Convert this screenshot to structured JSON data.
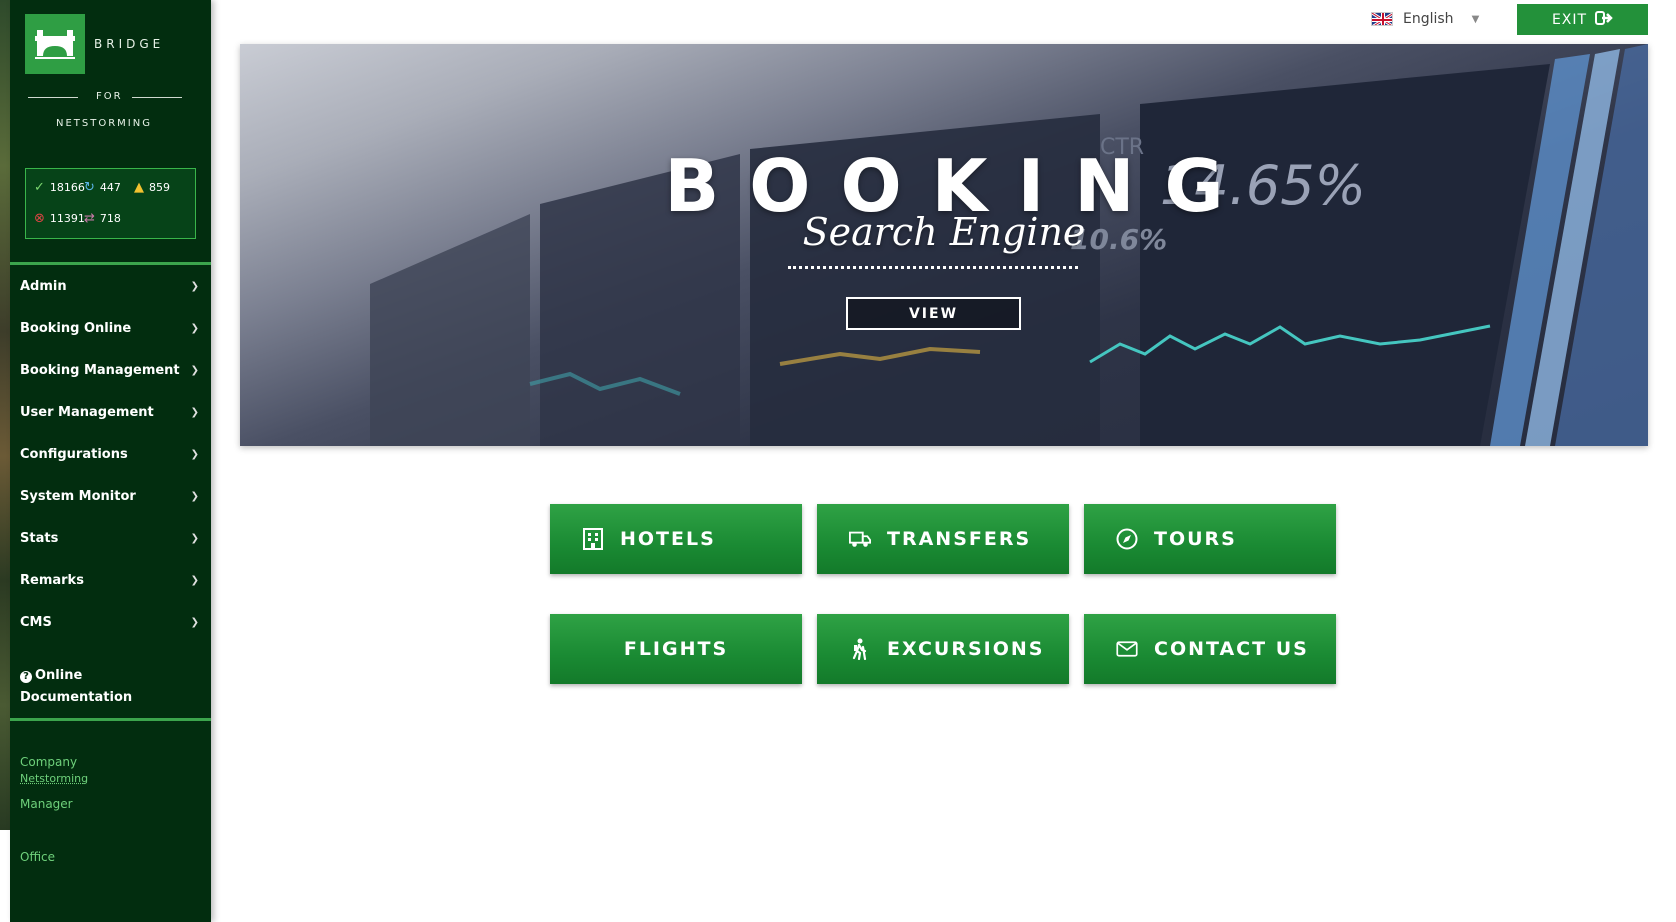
{
  "brand": {
    "name": "BRIDGE",
    "for": "FOR",
    "company": "NETSTORMING"
  },
  "stats": {
    "confirmed": "18166",
    "refreshing": "447",
    "warning": "859",
    "errors": "11391",
    "transfers": "718"
  },
  "nav": {
    "items": [
      {
        "label": "Admin"
      },
      {
        "label": "Booking Online"
      },
      {
        "label": "Booking Management"
      },
      {
        "label": "User Management"
      },
      {
        "label": "Configurations"
      },
      {
        "label": "System Monitor"
      },
      {
        "label": "Stats"
      },
      {
        "label": "Remarks"
      },
      {
        "label": "CMS"
      }
    ],
    "doc_line1": "Online",
    "doc_line2": "Documentation"
  },
  "footer": {
    "company_label": "Company",
    "company_value": "Netstorming",
    "manager_label": "Manager",
    "office_label": "Office"
  },
  "topbar": {
    "language": "English",
    "exit_label": "EXIT"
  },
  "banner": {
    "title": "BOOKING",
    "subtitle": "Search Engine",
    "view_label": "VIEW",
    "bg_text_1": "14.65%",
    "bg_text_2": "10.6%",
    "bg_text_3": "CTR"
  },
  "services": {
    "hotels": "HOTELS",
    "transfers": "TRANSFERS",
    "tours": "TOURS",
    "flights": "FLIGHTS",
    "excursions": "EXCURSIONS",
    "contact": "CONTACT US"
  },
  "colors": {
    "sidebar_bg": "#022d0f",
    "accent_green": "#23913a",
    "link_green": "#6ed07b"
  }
}
